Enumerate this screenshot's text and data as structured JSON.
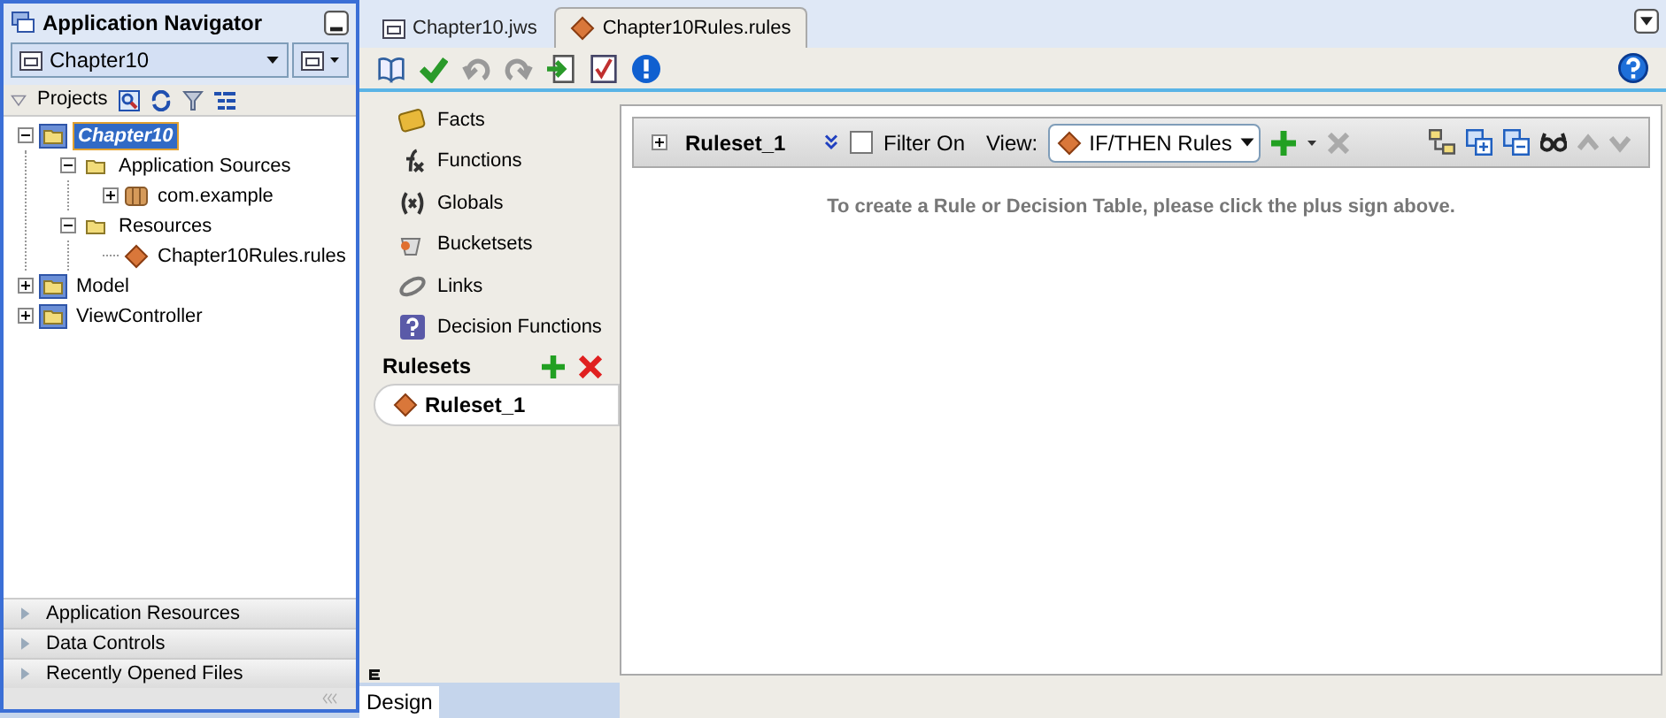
{
  "navigator": {
    "title": "Application Navigator",
    "application": "Chapter10",
    "projects_label": "Projects",
    "tree": [
      {
        "label": "Chapter10",
        "kind": "project",
        "selected": true,
        "expanded": true,
        "children": [
          {
            "label": "Application Sources",
            "kind": "folder",
            "selected": false,
            "expanded": true,
            "children": [
              {
                "label": "com.example",
                "kind": "package",
                "selected": false,
                "expanded": false
              }
            ]
          },
          {
            "label": "Resources",
            "kind": "folder",
            "selected": false,
            "expanded": true,
            "children": [
              {
                "label": "Chapter10Rules.rules",
                "kind": "rules",
                "selected": false
              }
            ]
          }
        ]
      },
      {
        "label": "Model",
        "kind": "project",
        "selected": false,
        "expanded": false
      },
      {
        "label": "ViewController",
        "kind": "project",
        "selected": false,
        "expanded": false
      }
    ],
    "sections": [
      "Application Resources",
      "Data Controls",
      "Recently Opened Files"
    ]
  },
  "editor_tabs": [
    {
      "label": "Chapter10.jws",
      "kind": "workspace",
      "selected": false
    },
    {
      "label": "Chapter10Rules.rules",
      "kind": "rules",
      "selected": true
    }
  ],
  "nav_items": [
    {
      "label": "Facts",
      "kind": "facts"
    },
    {
      "label": "Functions",
      "kind": "functions"
    },
    {
      "label": "Globals",
      "kind": "globals"
    },
    {
      "label": "Bucketsets",
      "kind": "bucketsets"
    },
    {
      "label": "Links",
      "kind": "links"
    },
    {
      "label": "Decision Functions",
      "kind": "decision"
    }
  ],
  "rulesets_label": "Rulesets",
  "rulesets": [
    {
      "label": "Ruleset_1",
      "selected": true
    }
  ],
  "ruleset_bar": {
    "name": "Ruleset_1",
    "filter_label": "Filter On",
    "filter_checked": false,
    "view_label": "View:",
    "view_value": "IF/THEN Rules"
  },
  "empty_message": "To create a Rule or Decision Table, please click the plus sign above.",
  "bottom_tabs": [
    {
      "label": "Design",
      "selected": true
    }
  ]
}
